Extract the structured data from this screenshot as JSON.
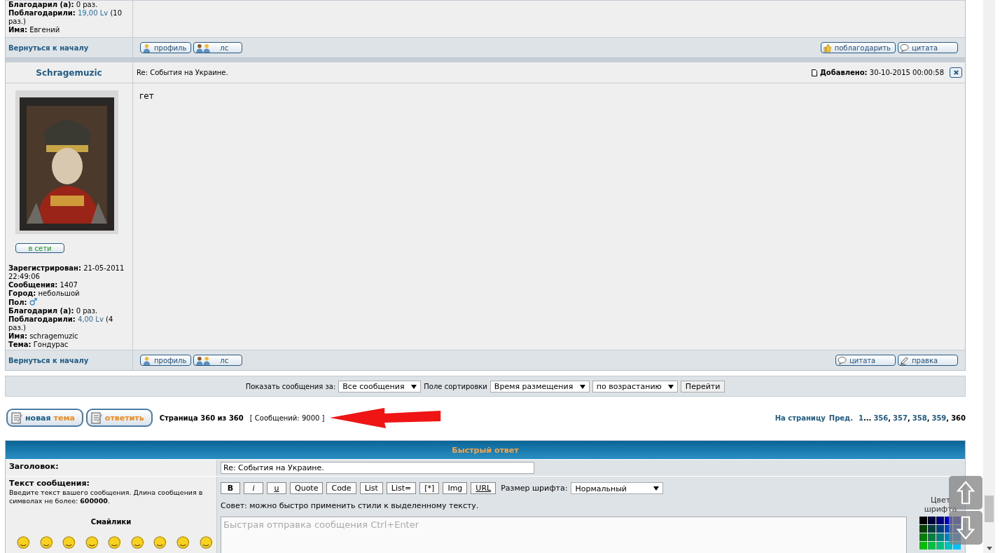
{
  "prev_post": {
    "stats": [
      {
        "kind": "text",
        "label": "Благодарил (а):",
        "value": "0 раз."
      },
      {
        "kind": "link",
        "label": "Поблагодарили:",
        "link": "19,00 Lv",
        "value": "(10 раз.)"
      },
      {
        "kind": "text",
        "label": "Имя:",
        "value": "Евгений"
      }
    ],
    "back_link": "Вернуться к началу",
    "left_buttons": [
      {
        "label": "профиль",
        "kind": "person"
      },
      {
        "label": "лс",
        "kind": "people"
      }
    ],
    "right_buttons": [
      {
        "label": "поблагодарить",
        "kind": "thumb"
      },
      {
        "label": "цитата",
        "kind": "speech"
      }
    ]
  },
  "post": {
    "author": "Schragemuzic",
    "subject": "Re: События на Украине.",
    "added_label": "Добавлено:",
    "added_date": "30-10-2015 00:00:58",
    "body": "гет",
    "online_button": "в сети",
    "stats": [
      {
        "kind": "text",
        "label": "Зарегистрирован:",
        "value": "21-05-2011 22:49:06"
      },
      {
        "kind": "text",
        "label": "Сообщения:",
        "value": "1407"
      },
      {
        "kind": "text",
        "label": "Город:",
        "value": "небольшой"
      },
      {
        "kind": "gender",
        "label": "Пол:"
      },
      {
        "kind": "text",
        "label": "Благодарил (а):",
        "value": "0 раз."
      },
      {
        "kind": "link",
        "label": "Поблагодарили:",
        "link": "4,00 Lv",
        "value": "(4 раз.)"
      },
      {
        "kind": "text",
        "label": "Имя:",
        "value": "schragemuzic"
      },
      {
        "kind": "text",
        "label": "Тема:",
        "value": "Гондурас"
      }
    ],
    "back_link": "Вернуться к началу",
    "left_buttons": [
      {
        "label": "профиль",
        "kind": "person"
      },
      {
        "label": "лс",
        "kind": "people"
      }
    ],
    "right_buttons": [
      {
        "label": "цитата",
        "kind": "speech"
      },
      {
        "label": "правка",
        "kind": "pencil"
      }
    ]
  },
  "sort_bar": {
    "show_label": "Показать сообщения за:",
    "show_select": "Все сообщения",
    "sort_label": "Поле сортировки",
    "sort_select": "Время размещения",
    "order_select": "по возрастанию",
    "go_button": "Перейти"
  },
  "pagination": {
    "buttons": [
      {
        "parts": [
          {
            "text": "новая",
            "accent": false
          },
          {
            "text": "тема",
            "accent": true
          }
        ]
      },
      {
        "parts": [
          {
            "text": "ответить",
            "accent": true
          }
        ]
      }
    ],
    "page_info": "Страница 360 из 360",
    "count": "[ Сообщений: 9000 ]",
    "pager_label": "На страницу",
    "pager_prev": "Пред.",
    "pages": [
      {
        "kind": "link",
        "label": "1"
      },
      {
        "kind": "sep",
        "label": "..."
      },
      {
        "kind": "link",
        "label": "356"
      },
      {
        "kind": "sep",
        "label": ","
      },
      {
        "kind": "link",
        "label": "357"
      },
      {
        "kind": "sep",
        "label": ","
      },
      {
        "kind": "link",
        "label": "358"
      },
      {
        "kind": "sep",
        "label": ","
      },
      {
        "kind": "link",
        "label": "359"
      },
      {
        "kind": "sep",
        "label": ","
      },
      {
        "kind": "current",
        "label": "360"
      }
    ]
  },
  "quick_reply": {
    "title": "Быстрый ответ",
    "subject_label": "Заголовок:",
    "subject_value": "Re: События на Украине.",
    "message_label": "Текст сообщения:",
    "message_hint": "Введите текст вашего сообщения. Длина сообщения в символах не более: **600000**.",
    "smileys_label": "Смайлики",
    "toolbar": [
      {
        "label": "B",
        "kind": "bold"
      },
      {
        "label": "i",
        "kind": "italic"
      },
      {
        "label": "u",
        "kind": "underline"
      },
      {
        "label": "Quote",
        "kind": "plain"
      },
      {
        "label": "Code",
        "kind": "plain"
      },
      {
        "label": "List",
        "kind": "plain"
      },
      {
        "label": "List=",
        "kind": "plain"
      },
      {
        "label": "[*]",
        "kind": "plain"
      },
      {
        "label": "Img",
        "kind": "plain"
      },
      {
        "label": "URL",
        "kind": "underline"
      }
    ],
    "font_size_label": "Размер шрифта:",
    "font_size_select": "Нормальный",
    "tip": "Совет: можно быстро применить стили к выделенному тексту.",
    "placeholder": "Быстрая отправка сообщения Ctrl+Enter",
    "color_label": "Цвет шрифта"
  }
}
